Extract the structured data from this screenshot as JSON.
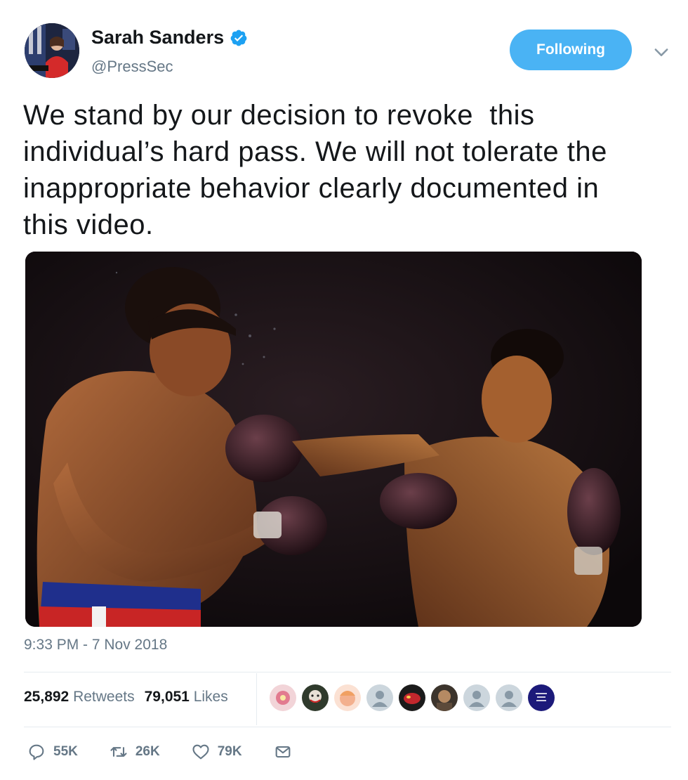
{
  "header": {
    "display_name": "Sarah Sanders",
    "handle": "@PressSec",
    "follow_label": "Following",
    "accent": "#4ab3f4",
    "verified_icon": "verified-badge-icon"
  },
  "tweet": {
    "text": "We stand by our decision to revoke  this\nindividual’s hard pass. We will not tolerate the\ninappropriate behavior clearly documented in\nthis video.",
    "media_alt_icon": "boxing-photo",
    "timestamp": "9:33 PM - 7 Nov 2018"
  },
  "stats": {
    "retweets_count": "25,892",
    "retweets_label": "Retweets",
    "likes_count": "79,051",
    "likes_label": "Likes"
  },
  "actions": {
    "reply_count": "55K",
    "retweet_count": "26K",
    "like_count": "79K"
  }
}
